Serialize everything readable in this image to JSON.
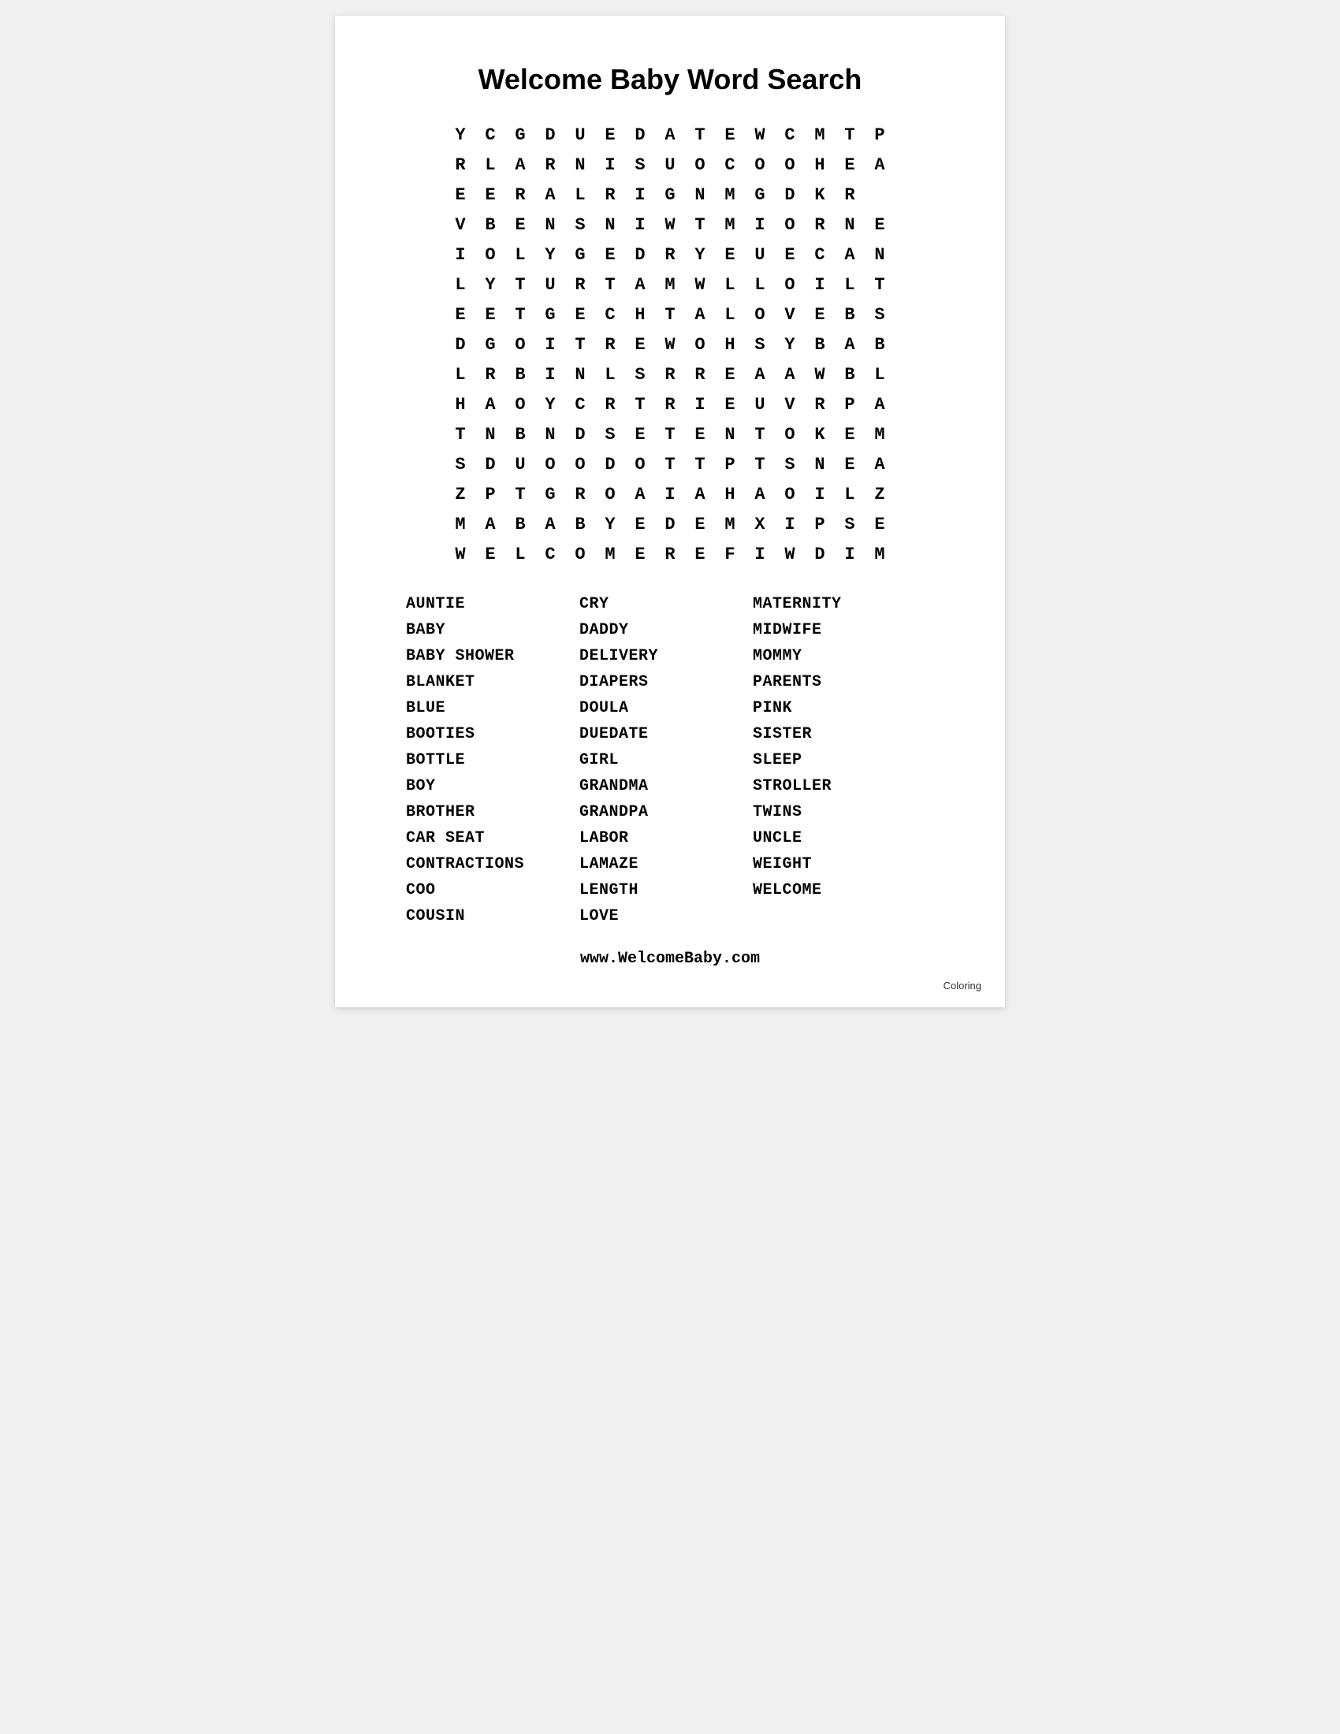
{
  "title": "Welcome Baby Word Search",
  "grid": [
    [
      "Y",
      "C",
      "G",
      "D",
      "U",
      "E",
      "D",
      "A",
      "T",
      "E",
      "W",
      "C",
      "M",
      "T",
      "P"
    ],
    [
      "R",
      "L",
      "A",
      "R",
      "N",
      "I",
      "S",
      "U",
      "O",
      "C",
      "O",
      "O",
      "H",
      "E",
      "A"
    ],
    [
      "E",
      "E",
      "R",
      "A",
      "L",
      "R",
      "I",
      "G",
      "N",
      "M",
      "G",
      "D",
      "K",
      "R",
      ""
    ],
    [
      "V",
      "B",
      "E",
      "N",
      "S",
      "N",
      "I",
      "W",
      "T",
      "M",
      "I",
      "O",
      "R",
      "N",
      "E"
    ],
    [
      "I",
      "O",
      "L",
      "Y",
      "G",
      "E",
      "D",
      "R",
      "Y",
      "E",
      "U",
      "E",
      "C",
      "A",
      "N"
    ],
    [
      "L",
      "Y",
      "T",
      "U",
      "R",
      "T",
      "A",
      "M",
      "W",
      "L",
      "L",
      "O",
      "I",
      "L",
      "T"
    ],
    [
      "E",
      "E",
      "T",
      "G",
      "E",
      "C",
      "H",
      "T",
      "A",
      "L",
      "O",
      "V",
      "E",
      "B",
      "S"
    ],
    [
      "D",
      "G",
      "O",
      "I",
      "T",
      "R",
      "E",
      "W",
      "O",
      "H",
      "S",
      "Y",
      "B",
      "A",
      "B"
    ],
    [
      "L",
      "R",
      "B",
      "I",
      "N",
      "L",
      "S",
      "R",
      "R",
      "E",
      "A",
      "A",
      "W",
      "B",
      "L"
    ],
    [
      "H",
      "A",
      "O",
      "Y",
      "C",
      "R",
      "T",
      "R",
      "I",
      "E",
      "U",
      "V",
      "R",
      "P",
      "A"
    ],
    [
      "T",
      "N",
      "B",
      "N",
      "D",
      "S",
      "E",
      "T",
      "E",
      "N",
      "T",
      "O",
      "K",
      "E",
      "M"
    ],
    [
      "S",
      "D",
      "U",
      "O",
      "O",
      "D",
      "O",
      "T",
      "T",
      "P",
      "T",
      "S",
      "N",
      "E",
      "A"
    ],
    [
      "Z",
      "P",
      "T",
      "G",
      "R",
      "O",
      "A",
      "I",
      "A",
      "H",
      "A",
      "O",
      "I",
      "L",
      "Z"
    ],
    [
      "M",
      "A",
      "B",
      "A",
      "B",
      "Y",
      "E",
      "D",
      "E",
      "M",
      "X",
      "I",
      "P",
      "S",
      "E"
    ],
    [
      "W",
      "E",
      "L",
      "C",
      "O",
      "M",
      "E",
      "R",
      "E",
      "F",
      "I",
      "W",
      "D",
      "I",
      "M"
    ]
  ],
  "words": {
    "col1": [
      "AUNTIE",
      "BABY",
      "BABY SHOWER",
      "BLANKET",
      "BLUE",
      "BOOTIES",
      "BOTTLE",
      "BOY",
      "BROTHER",
      "CAR SEAT",
      "CONTRACTIONS",
      "COO",
      "COUSIN"
    ],
    "col2": [
      "CRY",
      "DADDY",
      "DELIVERY",
      "DIAPERS",
      "DOULA",
      "DUEDATE",
      "GIRL",
      "GRANDMA",
      "GRANDPA",
      "LABOR",
      "LAMAZE",
      "LENGTH",
      "LOVE"
    ],
    "col3": [
      "MATERNITY",
      "MIDWIFE",
      "MOMMY",
      "PARENTS",
      "PINK",
      "SISTER",
      "SLEEP",
      "STROLLER",
      "TWINS",
      "UNCLE",
      "WEIGHT",
      "WELCOME",
      ""
    ]
  },
  "footer_url": "www.WelcomeBaby.com",
  "coloring_label": "Coloring"
}
